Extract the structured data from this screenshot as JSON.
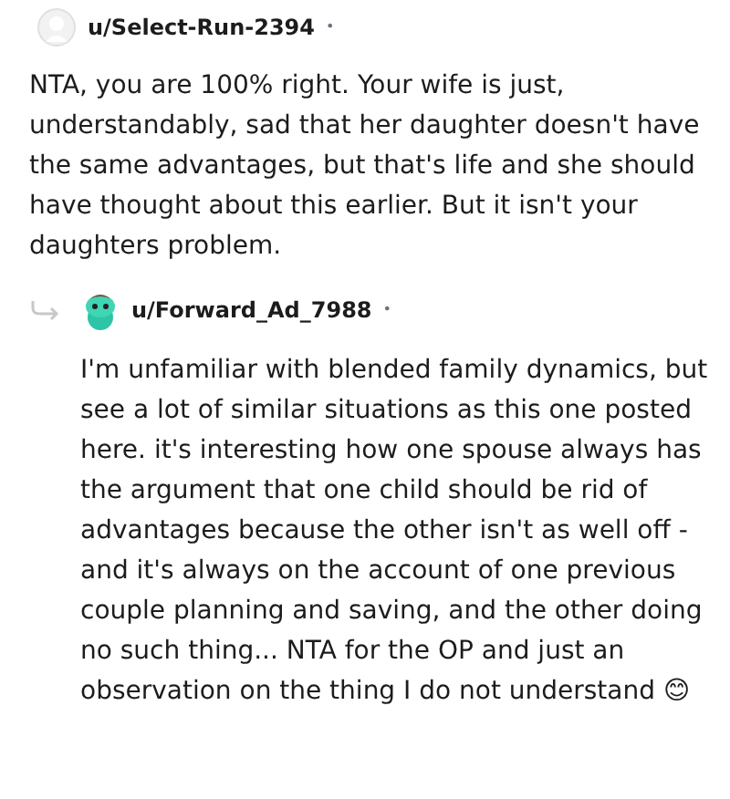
{
  "comments": [
    {
      "kind": "top",
      "username": "u/Select-Run-2394",
      "separator": "•",
      "body": "NTA, you are 100% right. Your wife is just, understandably, sad that her daughter doesn't have the same advantages, but that's life and she should have thought about this earlier. But it isn't your daughters problem."
    },
    {
      "kind": "reply",
      "username": "u/Forward_Ad_7988",
      "separator": "•",
      "body": "I'm unfamiliar with blended family dynamics, but see a lot of similar situations as this one posted here. it's interesting how one spouse always has the argument that one child should be rid of advantages because the other isn't as well off - and it's always on the account of one previous couple planning and saving, and the other doing no such thing... NTA for the OP and just an observation on the thing I do not understand 😊"
    }
  ]
}
